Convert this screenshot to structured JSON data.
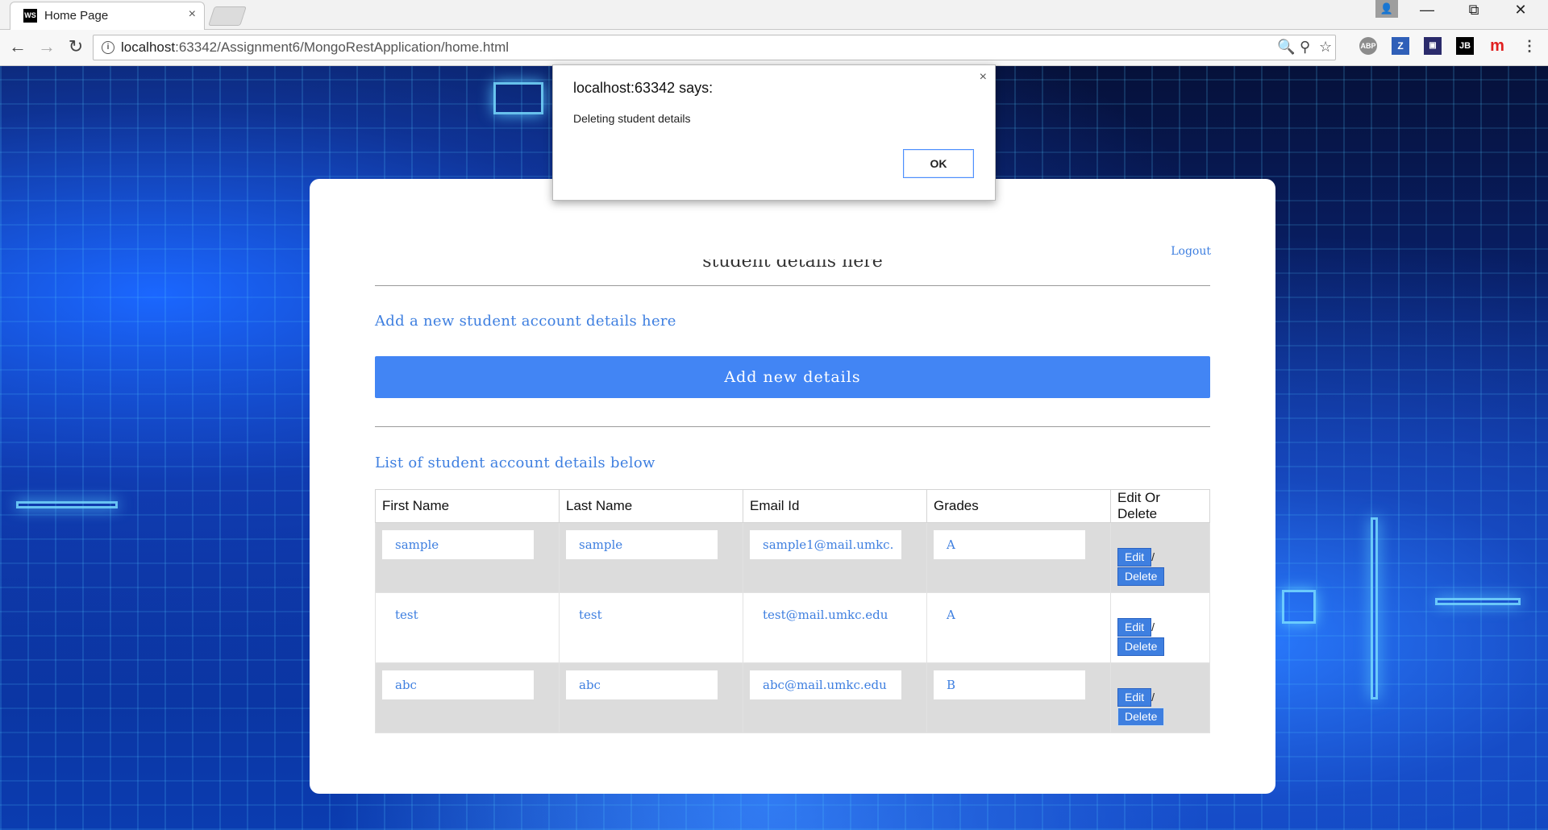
{
  "browser": {
    "tab_title": "Home Page",
    "tab_close": "×",
    "favicon_text": "WS",
    "url_host": "localhost",
    "url_rest": ":63342/Assignment6/MongoRestApplication/home.html",
    "extensions": [
      "ABP",
      "Z",
      "JB",
      "m"
    ]
  },
  "page": {
    "title": "student details here",
    "logout": "Logout",
    "add_heading": "Add a new student account details here",
    "add_button": "Add new details",
    "list_heading": "List of student account details below",
    "columns": [
      "First Name",
      "Last Name",
      "Email Id",
      "Grades",
      "Edit Or Delete"
    ],
    "rows": [
      {
        "first": "sample",
        "last": "sample",
        "email": "sample1@mail.umkc.",
        "grade": "A"
      },
      {
        "first": "test",
        "last": "test",
        "email": "test@mail.umkc.edu",
        "grade": "A"
      },
      {
        "first": "abc",
        "last": "abc",
        "email": "abc@mail.umkc.edu",
        "grade": "B"
      }
    ],
    "edit_label": "Edit",
    "slash": "/",
    "delete_label": "Delete"
  },
  "dialog": {
    "title": "localhost:63342 says:",
    "message": "Deleting student details",
    "ok": "OK",
    "close": "×"
  },
  "colors": {
    "accent": "#4285f4",
    "link": "#3e7fe0"
  }
}
